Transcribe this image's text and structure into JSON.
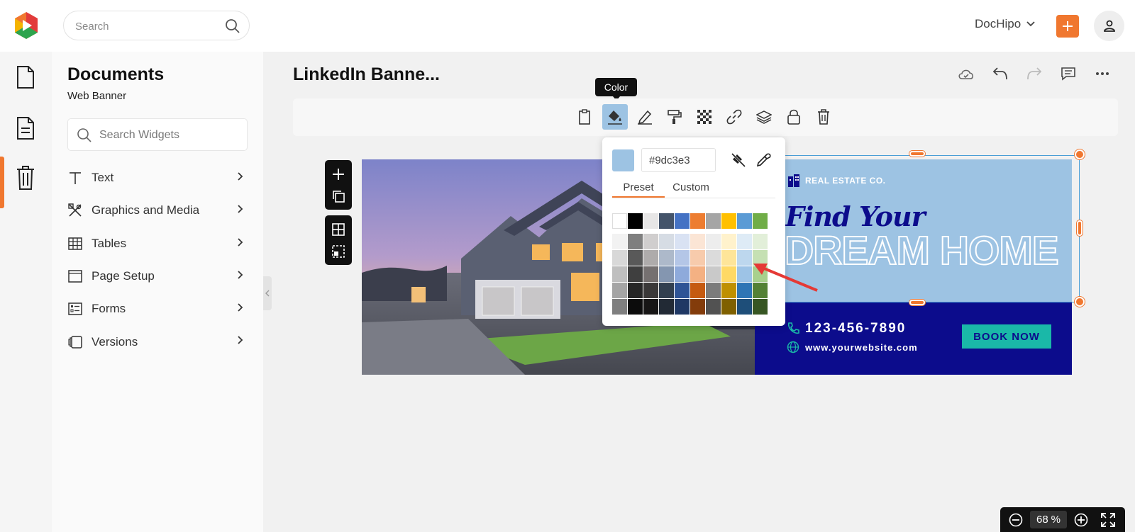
{
  "topbar": {
    "search_placeholder": "Search",
    "account_name": "DocHipo"
  },
  "sidebar": {
    "title": "Documents",
    "subtitle": "Web Banner",
    "widget_search_placeholder": "Search Widgets",
    "items": [
      {
        "label": "Text",
        "icon": "text-icon"
      },
      {
        "label": "Graphics and Media",
        "icon": "graphics-icon"
      },
      {
        "label": "Tables",
        "icon": "table-icon"
      },
      {
        "label": "Page Setup",
        "icon": "page-setup-icon"
      },
      {
        "label": "Forms",
        "icon": "forms-icon"
      },
      {
        "label": "Versions",
        "icon": "versions-icon"
      }
    ]
  },
  "editor": {
    "doc_title": "LinkedIn Banne...",
    "tooltip": "Color"
  },
  "color_picker": {
    "hex_value": "#9dc3e3",
    "tabs": [
      "Preset",
      "Custom"
    ],
    "selected_color": "#9dc3e3",
    "top_row": [
      "#ffffff",
      "#000000",
      "#e7e6e6",
      "#44546a",
      "#4472c4",
      "#ed7d31",
      "#a5a5a5",
      "#ffc000",
      "#5b9bd5",
      "#70ad47"
    ],
    "shade_rows": [
      [
        "#f2f2f2",
        "#7f7f7f",
        "#d0cece",
        "#d6dce4",
        "#d9e2f3",
        "#fbe5d5",
        "#ededed",
        "#fff2cc",
        "#deebf6",
        "#e2efd9"
      ],
      [
        "#d8d8d8",
        "#595959",
        "#aeabab",
        "#adb9ca",
        "#b4c6e7",
        "#f7cbac",
        "#dbdbdb",
        "#fee599",
        "#bdd7ee",
        "#c5e0b3"
      ],
      [
        "#bfbfbf",
        "#3f3f3f",
        "#757070",
        "#8496b0",
        "#8eaadb",
        "#f4b183",
        "#c9c9c9",
        "#ffd965",
        "#9dc3e6",
        "#a8d08d"
      ],
      [
        "#a5a5a5",
        "#262626",
        "#3a3838",
        "#323f4f",
        "#2f5496",
        "#c55a11",
        "#7b7b7b",
        "#bf9000",
        "#2e75b5",
        "#538135"
      ],
      [
        "#7f7f7f",
        "#0c0c0c",
        "#171616",
        "#222a35",
        "#1f3864",
        "#833c0b",
        "#525252",
        "#7f6000",
        "#1e4e79",
        "#375623"
      ]
    ]
  },
  "banner": {
    "company": "REAL ESTATE CO.",
    "headline_script": "Find Your",
    "headline_main": "DREAM HOME",
    "phone": "123-456-7890",
    "website": "www.yourwebsite.com",
    "cta": "BOOK NOW",
    "colors": {
      "light_panel": "#9dc3e3",
      "dark_panel": "#0c0c8c",
      "cta": "#1ab8a8"
    }
  },
  "zoom": {
    "value": "68",
    "unit": "%"
  },
  "colors": {
    "accent": "#f0772f",
    "selection": "#4a9ed6"
  }
}
